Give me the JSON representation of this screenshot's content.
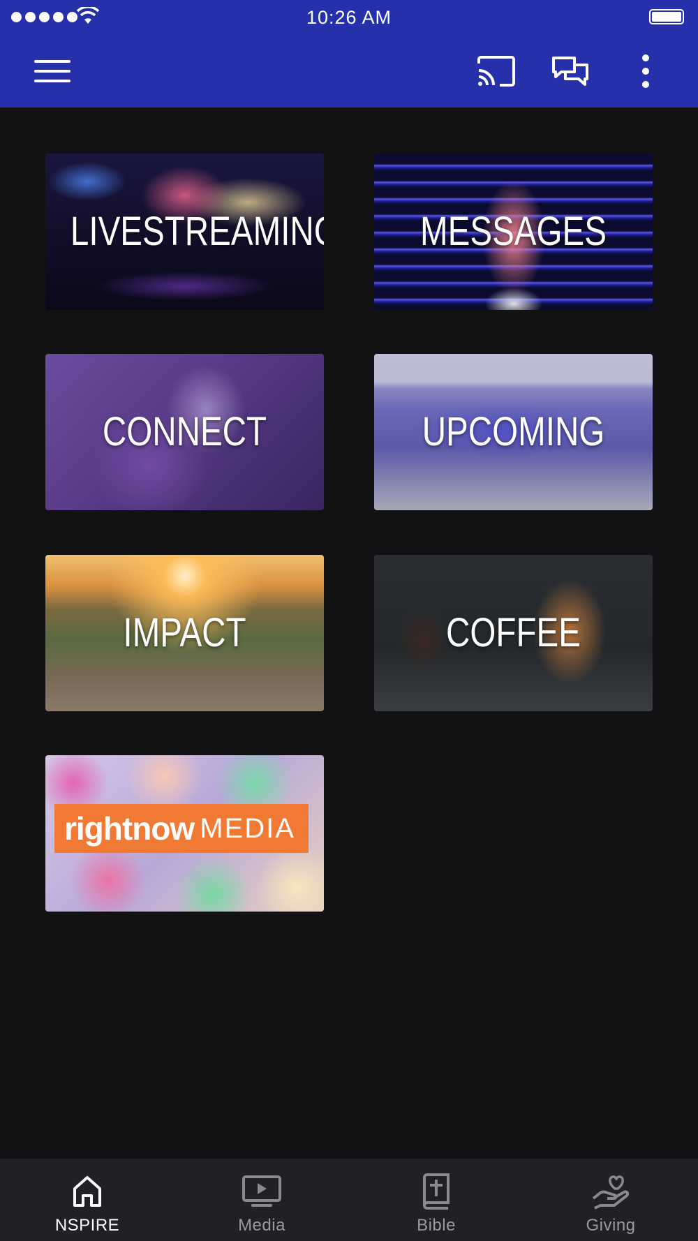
{
  "status_bar": {
    "time": "10:26 AM"
  },
  "app_bar": {
    "icons": [
      "menu-icon",
      "cast-icon",
      "chat-icon",
      "more-vert-icon"
    ]
  },
  "tiles": [
    {
      "label": "LIVESTREAMING"
    },
    {
      "label": "MESSAGES"
    },
    {
      "label": "CONNECT"
    },
    {
      "label": "UPCOMING"
    },
    {
      "label": "IMPACT"
    },
    {
      "label": "COFFEE"
    },
    {
      "logo_primary": "rightnow",
      "logo_secondary": "MEDIA"
    }
  ],
  "bottom_nav": {
    "items": [
      {
        "label": "NSPIRE",
        "icon": "home-icon",
        "active": true
      },
      {
        "label": "Media",
        "icon": "media-player-icon",
        "active": false
      },
      {
        "label": "Bible",
        "icon": "bible-icon",
        "active": false
      },
      {
        "label": "Giving",
        "icon": "giving-hand-heart-icon",
        "active": false
      }
    ]
  },
  "colors": {
    "app_bar": "#2730ab",
    "background": "#121215",
    "bottom_nav": "#202124",
    "logo_orange": "#f07a34"
  }
}
